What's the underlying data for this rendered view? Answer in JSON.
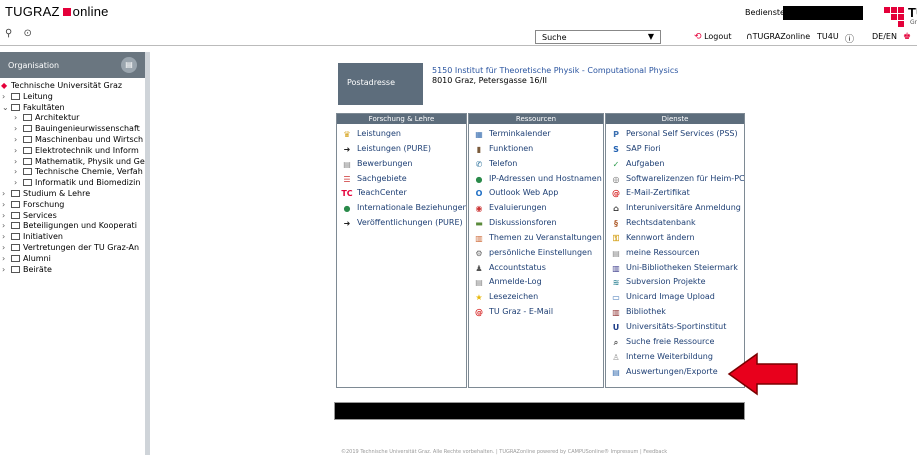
{
  "header": {
    "brand_left": "TUGRAZ",
    "brand_right": "online",
    "staff_label": "Bedienstete/r:",
    "logo_letters": "TU",
    "logo_sub": "Gr",
    "search_label": "Suche",
    "nav": {
      "logout": "Logout",
      "tugrazonline": "TUGRAZonline",
      "tu4u": "TU4U",
      "lang": "DE/EN"
    }
  },
  "sidebar": {
    "title": "Organisation",
    "root": "Technische Universität Graz",
    "items": [
      {
        "label": "Leitung",
        "indent": 1
      },
      {
        "label": "Fakultäten",
        "indent": 1,
        "open": true
      },
      {
        "label": "Architektur",
        "indent": 2
      },
      {
        "label": "Bauingenieurwissenschaft",
        "indent": 2
      },
      {
        "label": "Maschinenbau und Wirtsch",
        "indent": 2
      },
      {
        "label": "Elektrotechnik und Inform",
        "indent": 2
      },
      {
        "label": "Mathematik, Physik und Ge",
        "indent": 2
      },
      {
        "label": "Technische Chemie, Verfah",
        "indent": 2
      },
      {
        "label": "Informatik und Biomedizin",
        "indent": 2
      },
      {
        "label": "Studium & Lehre",
        "indent": 1
      },
      {
        "label": "Forschung",
        "indent": 1
      },
      {
        "label": "Services",
        "indent": 1
      },
      {
        "label": "Beteiligungen und Kooperati",
        "indent": 1
      },
      {
        "label": "Initiativen",
        "indent": 1
      },
      {
        "label": "Vertretungen der TU Graz-An",
        "indent": 1
      },
      {
        "label": "Alumni",
        "indent": 1
      },
      {
        "label": "Beiräte",
        "indent": 1
      }
    ]
  },
  "address": {
    "button": "Postadresse",
    "line1": "5150 Institut für Theoretische Physik - Computational Physics",
    "line2": "8010 Graz, Petersgasse 16/II"
  },
  "columns": [
    {
      "title": "Forschung & Lehre",
      "items": [
        {
          "label": "Leistungen",
          "icon": "trophy-icon",
          "color": "#d4a017",
          "glyph": "♛"
        },
        {
          "label": "Leistungen (PURE)",
          "icon": "pure-icon",
          "color": "#222222",
          "glyph": "➜"
        },
        {
          "label": "Bewerbungen",
          "icon": "document-icon",
          "color": "#888888",
          "glyph": "▤"
        },
        {
          "label": "Sachgebiete",
          "icon": "list-icon",
          "color": "#cc3333",
          "glyph": "☰"
        },
        {
          "label": "TeachCenter",
          "icon": "tc-icon",
          "color": "#e4003a",
          "glyph": "TC"
        },
        {
          "label": "Internationale Beziehungen",
          "icon": "globe-icon",
          "color": "#2a8a4a",
          "glyph": "●"
        },
        {
          "label": "Veröffentlichungen (PURE)",
          "icon": "pure-icon",
          "color": "#222222",
          "glyph": "➜"
        }
      ]
    },
    {
      "title": "Ressourcen",
      "items": [
        {
          "label": "Terminkalender",
          "icon": "calendar-icon",
          "color": "#3a6fb0",
          "glyph": "▦"
        },
        {
          "label": "Funktionen",
          "icon": "book-icon",
          "color": "#7a5a3a",
          "glyph": "▮"
        },
        {
          "label": "Telefon",
          "icon": "phone-icon",
          "color": "#2a6f9a",
          "glyph": "✆"
        },
        {
          "label": "IP-Adressen und Hostnamen",
          "icon": "network-icon",
          "color": "#2a8a4a",
          "glyph": "●"
        },
        {
          "label": "Outlook Web App",
          "icon": "outlook-icon",
          "color": "#1f6fc5",
          "glyph": "O"
        },
        {
          "label": "Evaluierungen",
          "icon": "evaluation-icon",
          "color": "#cc3333",
          "glyph": "◉"
        },
        {
          "label": "Diskussionsforen",
          "icon": "forum-icon",
          "color": "#5a8a3a",
          "glyph": "▬"
        },
        {
          "label": "Themen zu Veranstaltungen",
          "icon": "topics-icon",
          "color": "#cc6633",
          "glyph": "▥"
        },
        {
          "label": "persönliche Einstellungen",
          "icon": "settings-icon",
          "color": "#666666",
          "glyph": "⚙"
        },
        {
          "label": "Accountstatus",
          "icon": "account-icon",
          "color": "#555555",
          "glyph": "♟"
        },
        {
          "label": "Anmelde-Log",
          "icon": "log-icon",
          "color": "#888888",
          "glyph": "▤"
        },
        {
          "label": "Lesezeichen",
          "icon": "star-icon",
          "color": "#e8b80c",
          "glyph": "★"
        },
        {
          "label": "TU Graz - E-Mail",
          "icon": "at-icon",
          "color": "#d62020",
          "glyph": "@"
        }
      ]
    },
    {
      "title": "Dienste",
      "items": [
        {
          "label": "Personal Self Services (PSS)",
          "icon": "pss-icon",
          "color": "#3a6fb0",
          "glyph": "P"
        },
        {
          "label": "SAP Fiori",
          "icon": "sap-icon",
          "color": "#1f5fb0",
          "glyph": "S"
        },
        {
          "label": "Aufgaben",
          "icon": "tasks-icon",
          "color": "#2a9a4a",
          "glyph": "✓"
        },
        {
          "label": "Softwarelizenzen für Heim-PC",
          "icon": "disc-icon",
          "color": "#666666",
          "glyph": "◎"
        },
        {
          "label": "E-Mail-Zertifikat",
          "icon": "at-icon",
          "color": "#d62020",
          "glyph": "@"
        },
        {
          "label": "Interuniversitäre Anmeldung",
          "icon": "building-icon",
          "color": "#333333",
          "glyph": "⌂"
        },
        {
          "label": "Rechtsdatenbank",
          "icon": "law-icon",
          "color": "#b06030",
          "glyph": "§"
        },
        {
          "label": "Kennwort ändern",
          "icon": "key-icon",
          "color": "#d4a017",
          "glyph": "⚿"
        },
        {
          "label": "meine Ressourcen",
          "icon": "resources-icon",
          "color": "#888888",
          "glyph": "▤"
        },
        {
          "label": "Uni-Bibliotheken Steiermark",
          "icon": "library-icon",
          "color": "#3a3a8a",
          "glyph": "▥"
        },
        {
          "label": "Subversion Projekte",
          "icon": "svn-icon",
          "color": "#3a8a9a",
          "glyph": "≋"
        },
        {
          "label": "Unicard Image Upload",
          "icon": "upload-icon",
          "color": "#3a6fb0",
          "glyph": "▭"
        },
        {
          "label": "Bibliothek",
          "icon": "books-icon",
          "color": "#8a2a2a",
          "glyph": "▥"
        },
        {
          "label": "Universitäts-Sportinstitut",
          "icon": "sport-icon",
          "color": "#1f3f8a",
          "glyph": "U"
        },
        {
          "label": "Suche freie Ressource",
          "icon": "search-resource-icon",
          "color": "#555555",
          "glyph": "⌕"
        },
        {
          "label": "Interne Weiterbildung",
          "icon": "training-icon",
          "color": "#888888",
          "glyph": "♙"
        },
        {
          "label": "Auswertungen/Exporte",
          "icon": "export-icon",
          "color": "#3a6fb0",
          "glyph": "▤"
        }
      ]
    }
  ],
  "footer": "©2019 Technische Universität Graz. Alle Rechte vorbehalten. | TUGRAZonline powered by CAMPUSonline® Impressum | Feedback",
  "colors": {
    "accent": "#e4003a",
    "header_bg": "#5d6d7c",
    "link": "#1e3f74",
    "arrow": "#e8001c"
  }
}
